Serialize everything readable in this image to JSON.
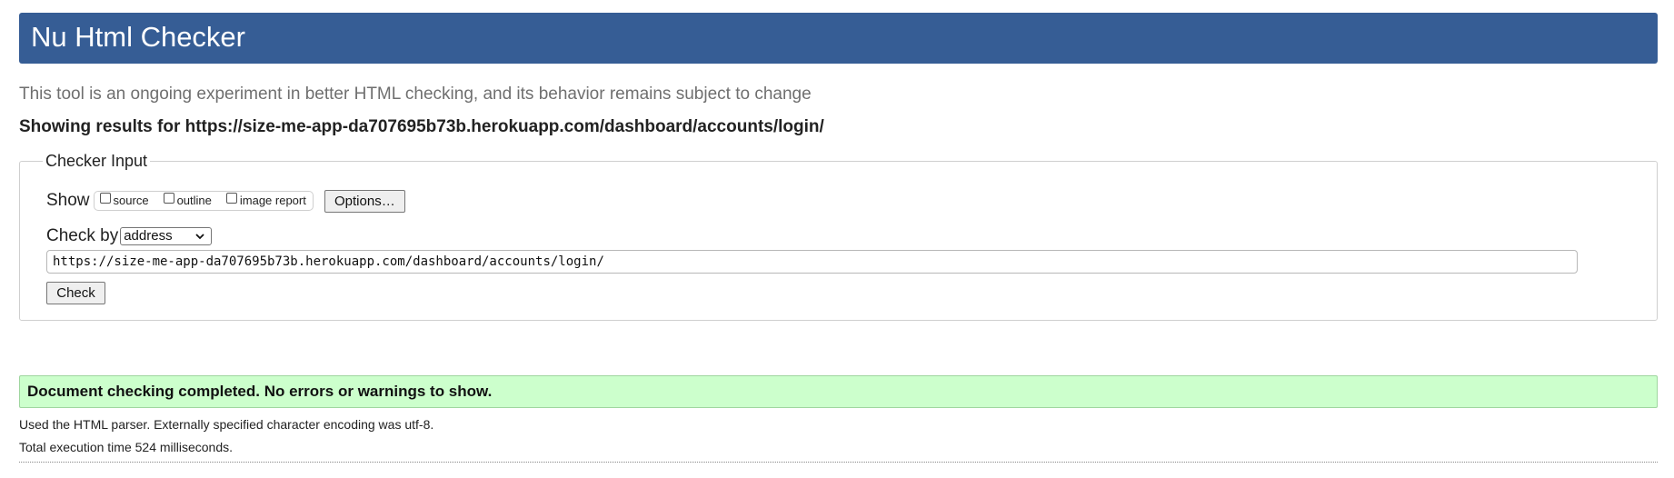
{
  "header": {
    "title": "Nu Html Checker"
  },
  "subtitle": "This tool is an ongoing experiment in better HTML checking, and its behavior remains subject to change",
  "results": {
    "heading": "Showing results for https://size-me-app-da707695b73b.herokuapp.com/dashboard/accounts/login/"
  },
  "checker_input": {
    "legend": "Checker Input",
    "show_label": "Show",
    "checkboxes": [
      {
        "label": "source",
        "checked": false
      },
      {
        "label": "outline",
        "checked": false
      },
      {
        "label": "image report",
        "checked": false
      }
    ],
    "options_label": "Options…",
    "check_by_label": "Check by",
    "check_by_value": "address",
    "url_value": "https://size-me-app-da707695b73b.herokuapp.com/dashboard/accounts/login/",
    "check_label": "Check"
  },
  "result_message": "Document checking completed. No errors or warnings to show.",
  "info": {
    "parser": "Used the HTML parser. Externally specified character encoding was utf-8.",
    "execution_time": "Total execution time 524 milliseconds."
  },
  "colors": {
    "header_bg": "#365d95",
    "success_bg": "#ccffcc"
  },
  "icons": {
    "select_arrow": "chevron-down-icon"
  }
}
